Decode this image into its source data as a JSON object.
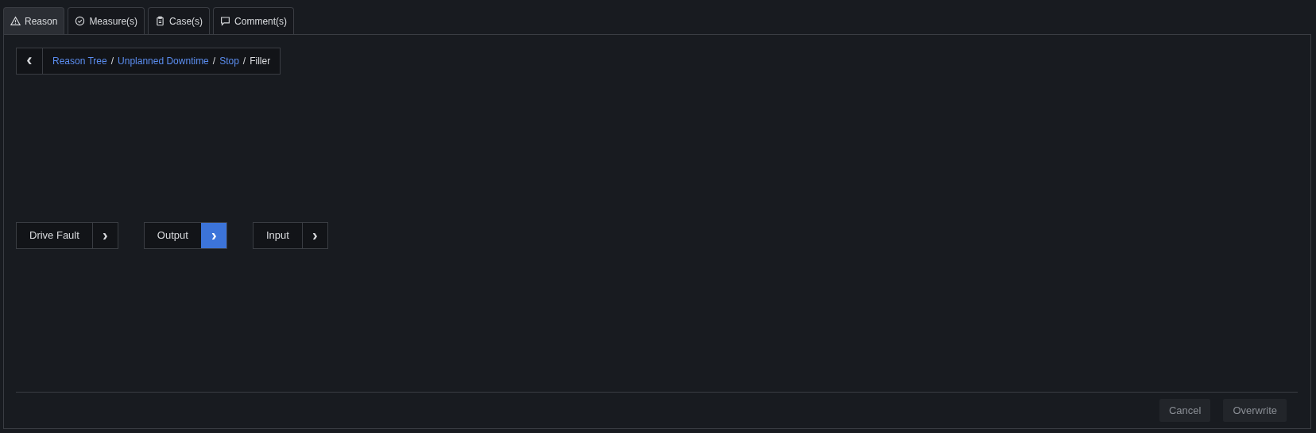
{
  "tabs": [
    {
      "label": "Reason",
      "selected": true
    },
    {
      "label": "Measure(s)",
      "selected": false
    },
    {
      "label": "Case(s)",
      "selected": false
    },
    {
      "label": "Comment(s)",
      "selected": false
    }
  ],
  "breadcrumb": {
    "back_icon": "‹",
    "items": [
      {
        "label": "Reason Tree",
        "link": true
      },
      {
        "label": "Unplanned Downtime",
        "link": true
      },
      {
        "label": "Stop",
        "link": true
      },
      {
        "label": "Filler",
        "link": false
      }
    ],
    "separator": "/"
  },
  "reasons": [
    {
      "label": "Drive Fault",
      "chevron": "›",
      "selected": false
    },
    {
      "label": "Output",
      "chevron": "›",
      "selected": true
    },
    {
      "label": "Input",
      "chevron": "›",
      "selected": false
    }
  ],
  "buttons": [
    {
      "label": "Cancel",
      "disabled": true
    },
    {
      "label": "Overwrite",
      "disabled": true
    }
  ]
}
